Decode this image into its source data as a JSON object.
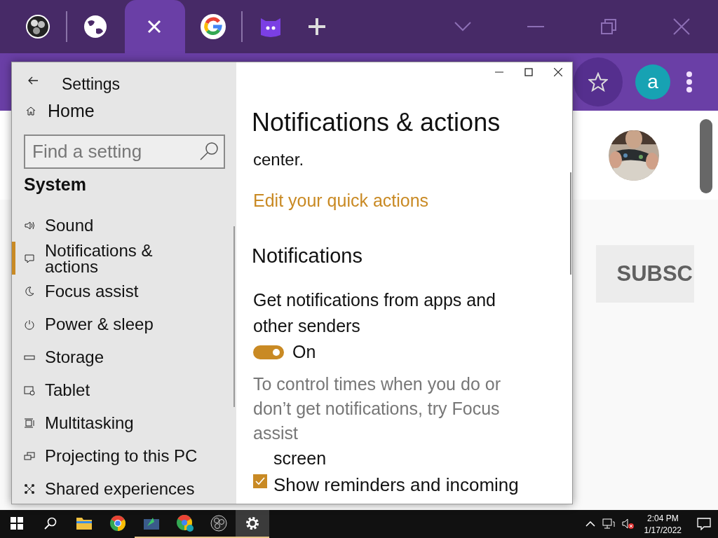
{
  "browser": {
    "tabs": [
      {
        "kind": "aperture",
        "selected": false
      },
      {
        "kind": "globe",
        "selected": false
      },
      {
        "kind": "blank",
        "selected": true
      },
      {
        "kind": "ring",
        "selected": false
      },
      {
        "kind": "chat",
        "selected": false
      }
    ],
    "avatar_letter": "a",
    "page": {
      "subscribe_button": "SUBSC"
    }
  },
  "settings": {
    "title": "Settings",
    "home": "Home",
    "search": {
      "placeholder": "Find a setting"
    },
    "section": "System",
    "nav": [
      {
        "kind": "sound",
        "label": "Sound",
        "selected": false
      },
      {
        "kind": "notifications",
        "label": "Notifications & actions",
        "selected": true
      },
      {
        "kind": "focus",
        "label": "Focus assist",
        "selected": false
      },
      {
        "kind": "power",
        "label": "Power & sleep",
        "selected": false
      },
      {
        "kind": "storage",
        "label": "Storage",
        "selected": false
      },
      {
        "kind": "tablet",
        "label": "Tablet",
        "selected": false
      },
      {
        "kind": "multitasking",
        "label": "Multitasking",
        "selected": false
      },
      {
        "kind": "projecting",
        "label": "Projecting to this PC",
        "selected": false
      },
      {
        "kind": "shared",
        "label": "Shared experiences",
        "selected": false
      }
    ],
    "content": {
      "heading": "Notifications & actions",
      "text_fragment": "center.",
      "link": "Edit your quick actions",
      "subheading": "Notifications",
      "toggle": {
        "label": "Get notifications from apps and other senders",
        "on": true,
        "state_text": "On"
      },
      "hint": "To control times when you do or don’t get notifications, try Focus assist",
      "continuation": "screen",
      "checkbox": {
        "label": "Show reminders and incoming",
        "checked": true
      }
    }
  },
  "taskbar": {
    "apps": [
      {
        "kind": "start",
        "running": false,
        "selected": false
      },
      {
        "kind": "search",
        "running": false,
        "selected": false
      },
      {
        "kind": "folder",
        "running": false,
        "selected": false
      },
      {
        "kind": "browser",
        "running": false,
        "selected": false
      },
      {
        "kind": "photos",
        "running": true,
        "selected": false
      },
      {
        "kind": "browser_profile",
        "running": true,
        "selected": false
      },
      {
        "kind": "aperture",
        "running": true,
        "selected": false
      },
      {
        "kind": "gear",
        "running": true,
        "selected": true
      }
    ],
    "time": "2:04 PM",
    "date": "1/17/2022"
  }
}
